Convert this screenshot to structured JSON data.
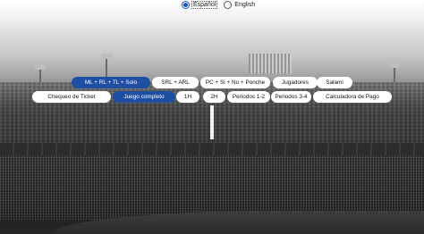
{
  "language": {
    "options": [
      {
        "label": "Español",
        "selected": true
      },
      {
        "label": "English",
        "selected": false
      }
    ]
  },
  "tabs_row1": [
    {
      "label": "ML + RL + TL + Solo",
      "active": true
    },
    {
      "label": "SRL + ARL",
      "active": false
    },
    {
      "label": "PC + Si + No + Ponche",
      "active": false
    },
    {
      "label": "Jugadores",
      "active": false
    },
    {
      "label": "Salami",
      "active": false
    }
  ],
  "tabs_row2": [
    {
      "label": "Chequeo de Ticket",
      "active": false
    },
    {
      "label": "Juego completo",
      "active": true
    },
    {
      "label": "1H",
      "active": false
    },
    {
      "label": "2H",
      "active": false
    },
    {
      "label": "Periodos 1-2",
      "active": false
    },
    {
      "label": "Periodos 3-4",
      "active": false
    },
    {
      "label": "Calculadora de Pago",
      "active": false
    }
  ],
  "colors": {
    "active_tab": "#1e4fa3",
    "radio_accent": "#1656c4",
    "tab_background": "#ffffff"
  }
}
